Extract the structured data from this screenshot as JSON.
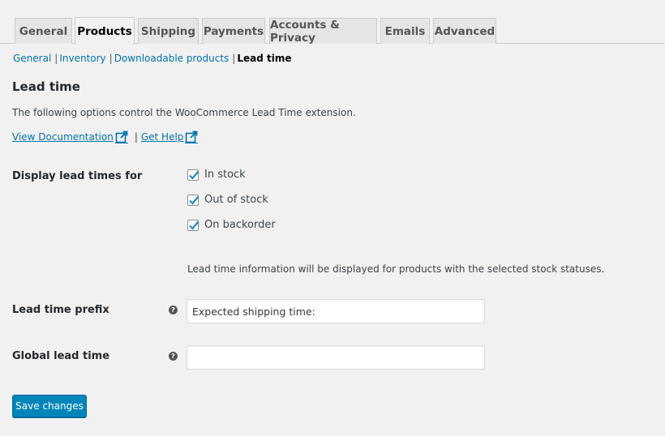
{
  "tabs": [
    {
      "label": "General"
    },
    {
      "label": "Products"
    },
    {
      "label": "Shipping"
    },
    {
      "label": "Payments"
    },
    {
      "label": "Accounts & Privacy"
    },
    {
      "label": "Emails"
    },
    {
      "label": "Advanced"
    }
  ],
  "active_tab": "Products",
  "subnav": {
    "items": [
      "General",
      "Inventory",
      "Downloadable products"
    ],
    "current": "Lead time",
    "separator": "|"
  },
  "section": {
    "title": "Lead time",
    "description": "The following options control the WooCommerce Lead Time extension.",
    "doc_link": "View Documentation",
    "help_link": "Get Help",
    "link_separator": "|"
  },
  "display_lead_times": {
    "label": "Display lead times for",
    "options": [
      {
        "label": "In stock",
        "checked": true
      },
      {
        "label": "Out of stock",
        "checked": true
      },
      {
        "label": "On backorder",
        "checked": true
      }
    ],
    "description": "Lead time information will be displayed for products with the selected stock statuses."
  },
  "prefix": {
    "label": "Lead time prefix",
    "value": "Expected shipping time:",
    "help": "?"
  },
  "global_lead_time": {
    "label": "Global lead time",
    "value": "",
    "help": "?"
  },
  "save_button": {
    "label": "Save changes"
  },
  "colors": {
    "link": "#0073aa",
    "primary_button": "#0085ba",
    "background": "#f1f1f1",
    "check": "#1e8cbe"
  },
  "icons": {
    "external": "external-link-icon",
    "help": "help-icon",
    "check": "checkmark-icon"
  }
}
